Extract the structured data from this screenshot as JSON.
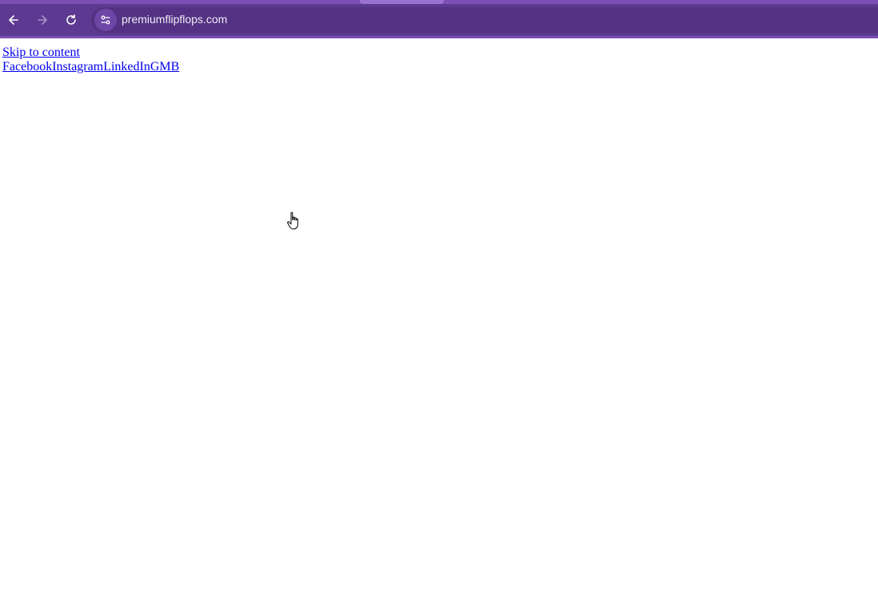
{
  "browser": {
    "url": "premiumflipflops.com",
    "icons": {
      "back": "arrow-left-icon",
      "forward": "arrow-right-icon",
      "reload": "reload-icon",
      "site_info": "tune-icon"
    },
    "colors": {
      "frame": "#6a3fa0",
      "toolbar": "#5d3a91",
      "omnibox": "#533283",
      "url_text": "#f1ecf8"
    }
  },
  "page": {
    "skip_link": "Skip to content",
    "social_links": [
      "Facebook",
      "Instagram",
      "LinkedIn",
      "GMB"
    ],
    "link_color": "#0000ee"
  },
  "cursor": {
    "icon": "hand-pointer-icon"
  }
}
